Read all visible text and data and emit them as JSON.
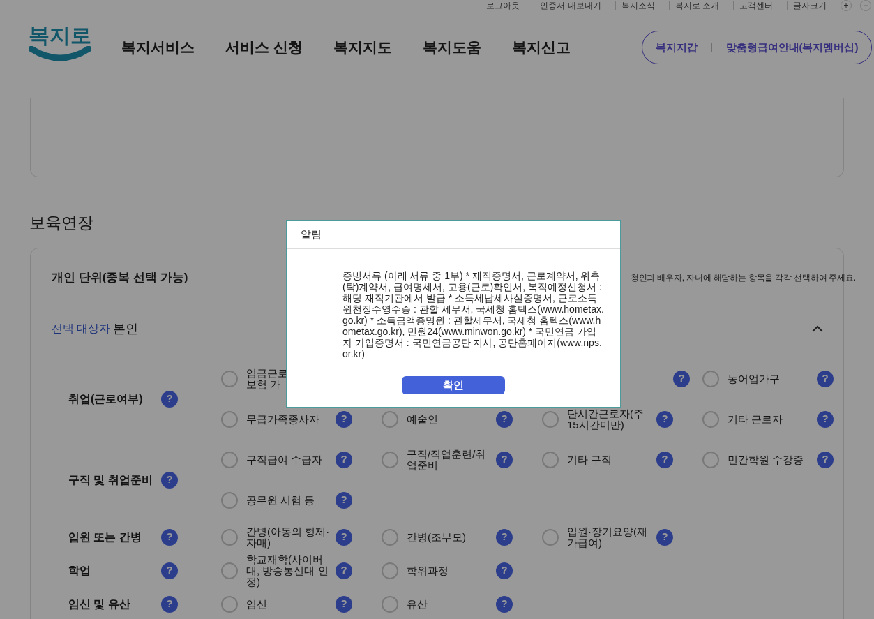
{
  "top_links": [
    "로그아웃",
    "인증서 내보내기",
    "복지소식",
    "복지로 소개",
    "고객센터",
    "글자크기"
  ],
  "font_size_buttons": [
    "+",
    "−"
  ],
  "logo": "복지로",
  "nav": [
    "복지서비스",
    "서비스 신청",
    "복지지도",
    "복지도움",
    "복지신고"
  ],
  "member_links": [
    "복지지갑",
    "맞춤형급여안내(복지멤버십)"
  ],
  "section_title": "보육연장",
  "panel": {
    "title": "개인 단위(중복 선택 가능)",
    "hint": "청인과 배우자, 자녀에 해당하는 항목을 각각 선택하여 주세요.",
    "target_label": "선택 대상자",
    "target": "본인",
    "expanded": true,
    "categories": [
      {
        "label": "취업(근로여부)",
        "help": "?",
        "rows": [
          [
            {
              "kind": "option",
              "label": "임금근로\n보험 가",
              "selected": false
            },
            {
              "kind": "covered"
            },
            {
              "kind": "help-only",
              "help": "?"
            },
            {
              "kind": "option",
              "label": "농어업가구",
              "selected": false,
              "help": "?"
            }
          ],
          [
            {
              "kind": "option",
              "label": "무급가족종사자",
              "selected": false,
              "help": "?"
            },
            {
              "kind": "option",
              "label": "예술인",
              "selected": false,
              "help": "?"
            },
            {
              "kind": "option",
              "label": "단시간근로자(주 15시간미만)",
              "selected": false,
              "help": "?"
            },
            {
              "kind": "option",
              "label": "기타 근로자",
              "selected": false,
              "help": "?"
            }
          ]
        ]
      },
      {
        "label": "구직 및 취업준비",
        "help": "?",
        "rows": [
          [
            {
              "kind": "option",
              "label": "구직급여 수급자",
              "selected": false,
              "help": "?"
            },
            {
              "kind": "option",
              "label": "구직/직업훈련/취업준비",
              "selected": false,
              "help": "?"
            },
            {
              "kind": "option",
              "label": "기타 구직",
              "selected": false,
              "help": "?"
            },
            {
              "kind": "option",
              "label": "민간학원 수강증",
              "selected": false,
              "help": "?"
            }
          ],
          [
            {
              "kind": "option",
              "label": "공무원 시험 등",
              "selected": false,
              "help": "?"
            }
          ]
        ]
      },
      {
        "label": "입원 또는 간병",
        "help": "?",
        "rows": [
          [
            {
              "kind": "option",
              "label": "간병(아동의 형제·자매)",
              "selected": false,
              "help": "?"
            },
            {
              "kind": "option",
              "label": "간병(조부모)",
              "selected": false,
              "help": "?"
            },
            {
              "kind": "option",
              "label": "입원·장기요양(재가급여)",
              "selected": false,
              "help": "?"
            }
          ]
        ]
      },
      {
        "label": "학업",
        "help": "?",
        "rows": [
          [
            {
              "kind": "option",
              "label": "학교재학(사이버대, 방송통신대 인정)",
              "selected": false,
              "help": "?"
            },
            {
              "kind": "option",
              "label": "학위과정",
              "selected": false,
              "help": "?"
            }
          ]
        ]
      },
      {
        "label": "임신 및 유산",
        "help": "?",
        "rows": [
          [
            {
              "kind": "option",
              "label": "임신",
              "selected": false,
              "help": "?"
            },
            {
              "kind": "option",
              "label": "유산",
              "selected": false,
              "help": "?"
            }
          ]
        ]
      }
    ]
  },
  "dialog": {
    "title": "알림",
    "message": "증빙서류 (아래 서류 중 1부) * 재직증명서, 근로계약서, 위촉(탁)계약서, 급여명세서, 고용(근로)확인서, 복직예정신청서 : 해당 재직기관에서 발급 * 소득세납세사실증명서, 근로소득원천징수영수증 : 관할 세무서, 국세청 홈텍스(www.hometax.go.kr) * 소득금액증명원 : 관할세무서, 국세청 홈텍스(www.hometax.go.kr), 민원24(www.minwon.go.kr) * 국민연금 가입자 가입증명서 : 국민연금공단 지사, 공단홈페이지(www.nps.or.kr)",
    "button": "확인"
  }
}
